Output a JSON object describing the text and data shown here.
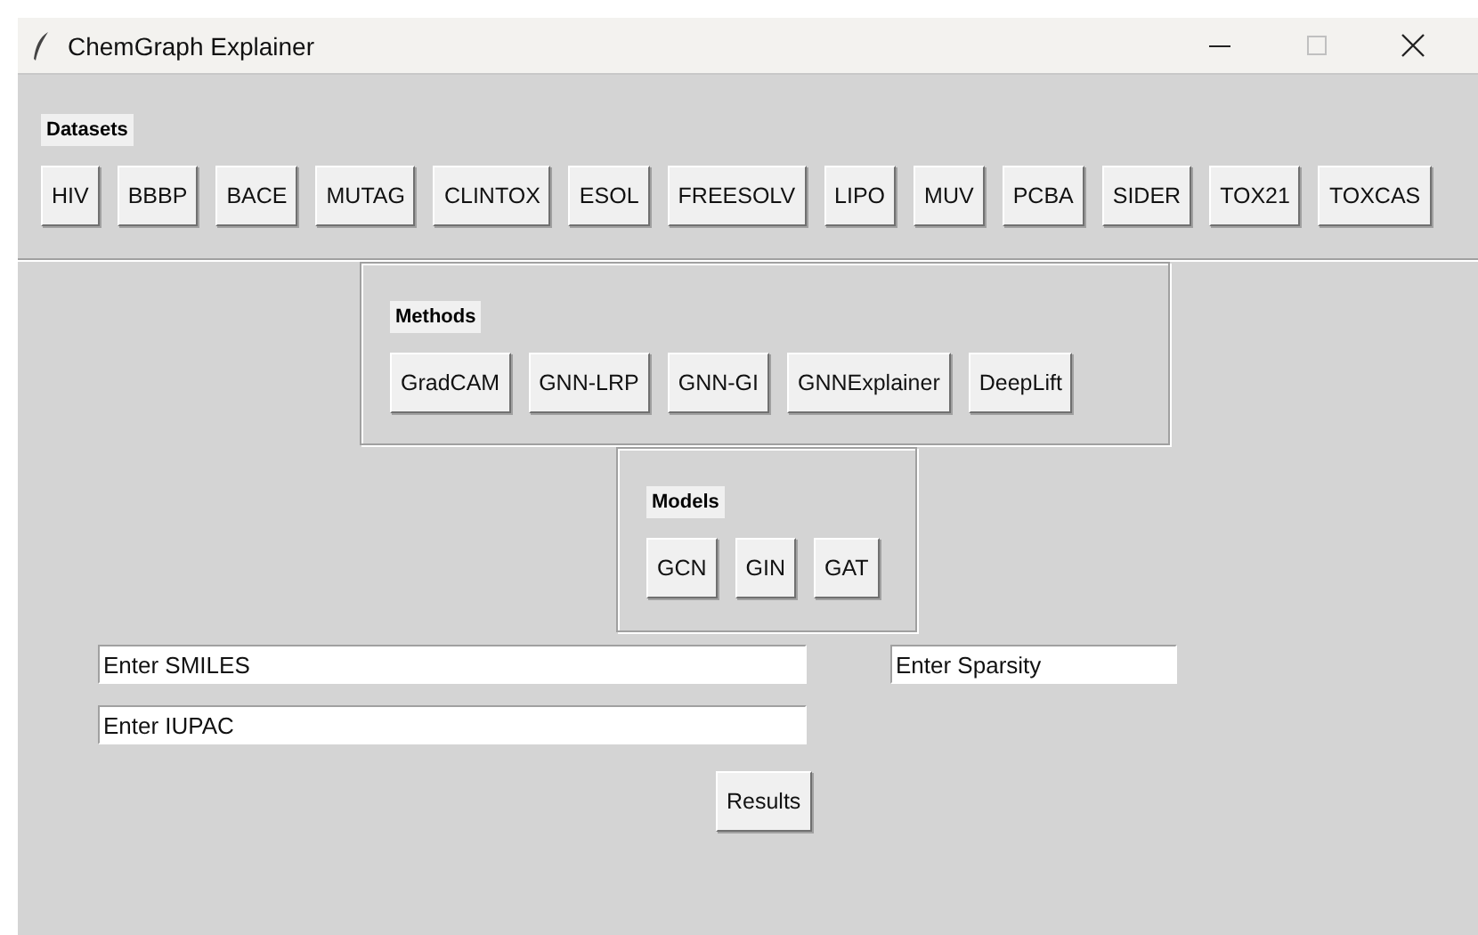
{
  "window": {
    "title": "ChemGraph Explainer"
  },
  "datasets": {
    "label": "Datasets",
    "buttons": [
      "HIV",
      "BBBP",
      "BACE",
      "MUTAG",
      "CLINTOX",
      "ESOL",
      "FREESOLV",
      "LIPO",
      "MUV",
      "PCBA",
      "SIDER",
      "TOX21",
      "TOXCAS"
    ]
  },
  "methods": {
    "label": "Methods",
    "buttons": [
      "GradCAM",
      "GNN-LRP",
      "GNN-GI",
      "GNNExplainer",
      "DeepLift"
    ]
  },
  "models": {
    "label": "Models",
    "buttons": [
      "GCN",
      "GIN",
      "GAT"
    ]
  },
  "fields": [
    {
      "value": "Enter SMILES"
    },
    {
      "value": "Enter Sparsity"
    },
    {
      "value": "Enter IUPAC"
    }
  ],
  "results_button": "Results"
}
